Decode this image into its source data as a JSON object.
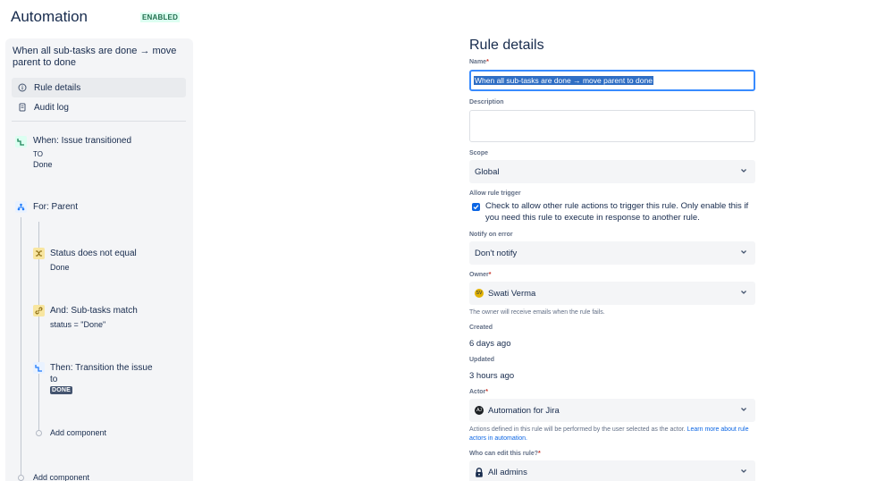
{
  "header": {
    "title": "Automation",
    "status_badge": "ENABLED"
  },
  "sidebar": {
    "rule_name": "When all sub-tasks are done → move parent to done",
    "nav": [
      {
        "label": "Rule details",
        "icon": "info-icon"
      },
      {
        "label": "Audit log",
        "icon": "document-icon"
      }
    ],
    "components": {
      "trigger": {
        "title": "When: Issue transitioned",
        "to_label": "TO",
        "to_value": "Done",
        "icon": "transition-icon"
      },
      "branch": {
        "title": "For: Parent",
        "icon": "branch-icon"
      },
      "condition1": {
        "title": "Status does not equal",
        "value": "Done",
        "icon": "shuffle-icon"
      },
      "condition2": {
        "title": "And: Sub-tasks match",
        "value": "status = \"Done\"",
        "icon": "link-icon"
      },
      "action": {
        "title_line1": "Then: Transition the issue",
        "title_line2": "to",
        "tag": "DONE",
        "icon": "transition-icon"
      }
    },
    "add_component_inner": "Add component",
    "add_component_outer": "Add component"
  },
  "panel": {
    "title": "Rule details",
    "name_label": "Name",
    "name_value": "When all sub-tasks are done → move parent to done",
    "description_label": "Description",
    "scope_label": "Scope",
    "scope_value": "Global",
    "allow_trigger_label": "Allow rule trigger",
    "allow_trigger_text": "Check to allow other rule actions to trigger this rule. Only enable this if you need this rule to execute in response to another rule.",
    "allow_trigger_checked": true,
    "notify_label": "Notify on error",
    "notify_value": "Don't notify",
    "owner_label": "Owner",
    "owner_value": "Swati Verma",
    "owner_initials": "SV",
    "owner_helper": "The owner will receive emails when the rule fails.",
    "created_label": "Created",
    "created_value": "6 days ago",
    "updated_label": "Updated",
    "updated_value": "3 hours ago",
    "actor_label": "Actor",
    "actor_value": "Automation for Jira",
    "actor_initials": "AJ",
    "actor_helper": "Actions defined in this rule will be performed by the user selected as the actor.",
    "actor_helper_link": "Learn more about rule actors in automation.",
    "who_edit_label": "Who can edit this rule?",
    "who_edit_value": "All admins",
    "required_mark": "*"
  },
  "colors": {
    "accent": "#0c66e4",
    "trigger_icon_bg": "#dcfff1",
    "branch_icon_bg": "#e9f2ff",
    "condition_icon_bg": "#f8e6a0",
    "action_icon_bg": "#e9f2ff",
    "owner_avatar": "#e2b203",
    "actor_avatar": "#1d2125"
  }
}
